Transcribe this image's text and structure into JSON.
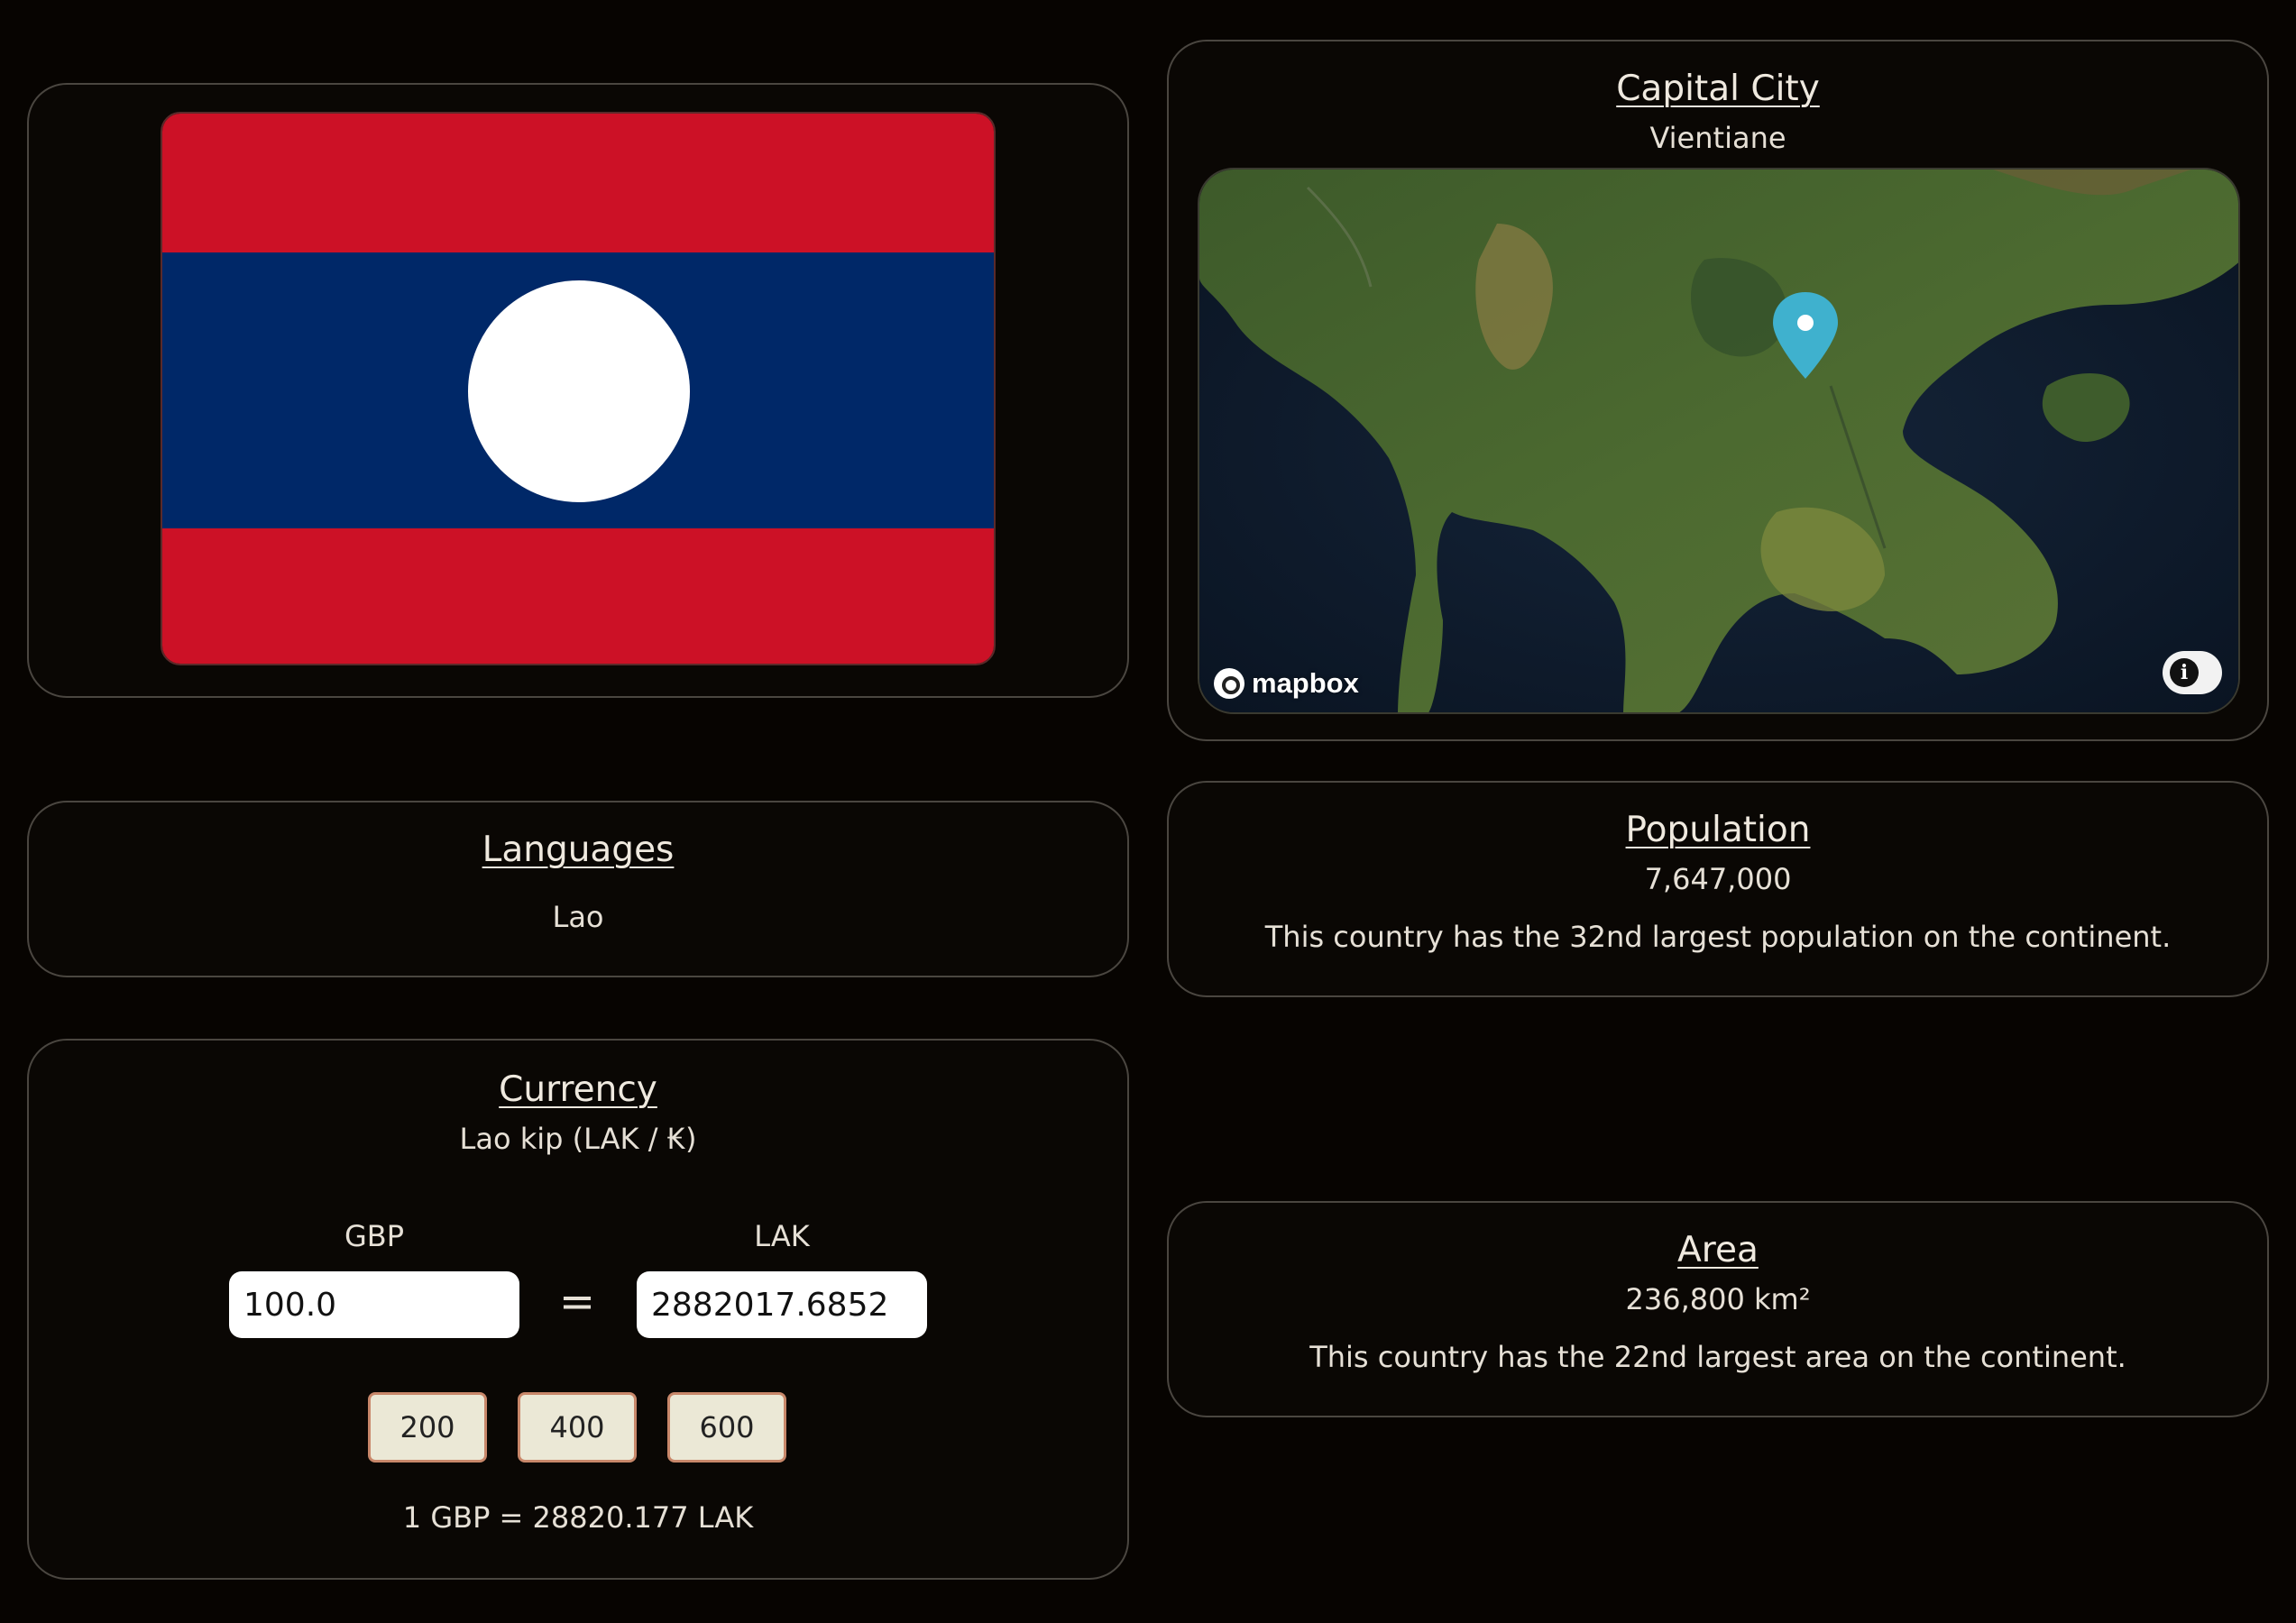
{
  "flag": {
    "country": "Laos",
    "colors": {
      "red": "#cc1126",
      "blue": "#002868",
      "disc": "#ffffff"
    }
  },
  "capital": {
    "title": "Capital City",
    "value": "Vientiane",
    "map": {
      "attribution_logo": "mapbox",
      "marker_icon": "map-pin-icon",
      "marker_color": "#3fb1ce",
      "info_icon": "info-icon"
    }
  },
  "languages": {
    "title": "Languages",
    "value": "Lao"
  },
  "population": {
    "title": "Population",
    "value": "7,647,000",
    "note": "This country has the 32nd largest population on the continent."
  },
  "currency": {
    "title": "Currency",
    "value": "Lao kip (LAK / ₭)",
    "from_label": "GBP",
    "to_label": "LAK",
    "from_value": "100.0",
    "to_value": "2882017.6852",
    "equals": "=",
    "amount_buttons": [
      "200",
      "400",
      "600"
    ],
    "rate": "1 GBP = 28820.177 LAK"
  },
  "area": {
    "title": "Area",
    "value": "236,800 km²",
    "note": "This country has the 22nd largest area on the continent."
  }
}
